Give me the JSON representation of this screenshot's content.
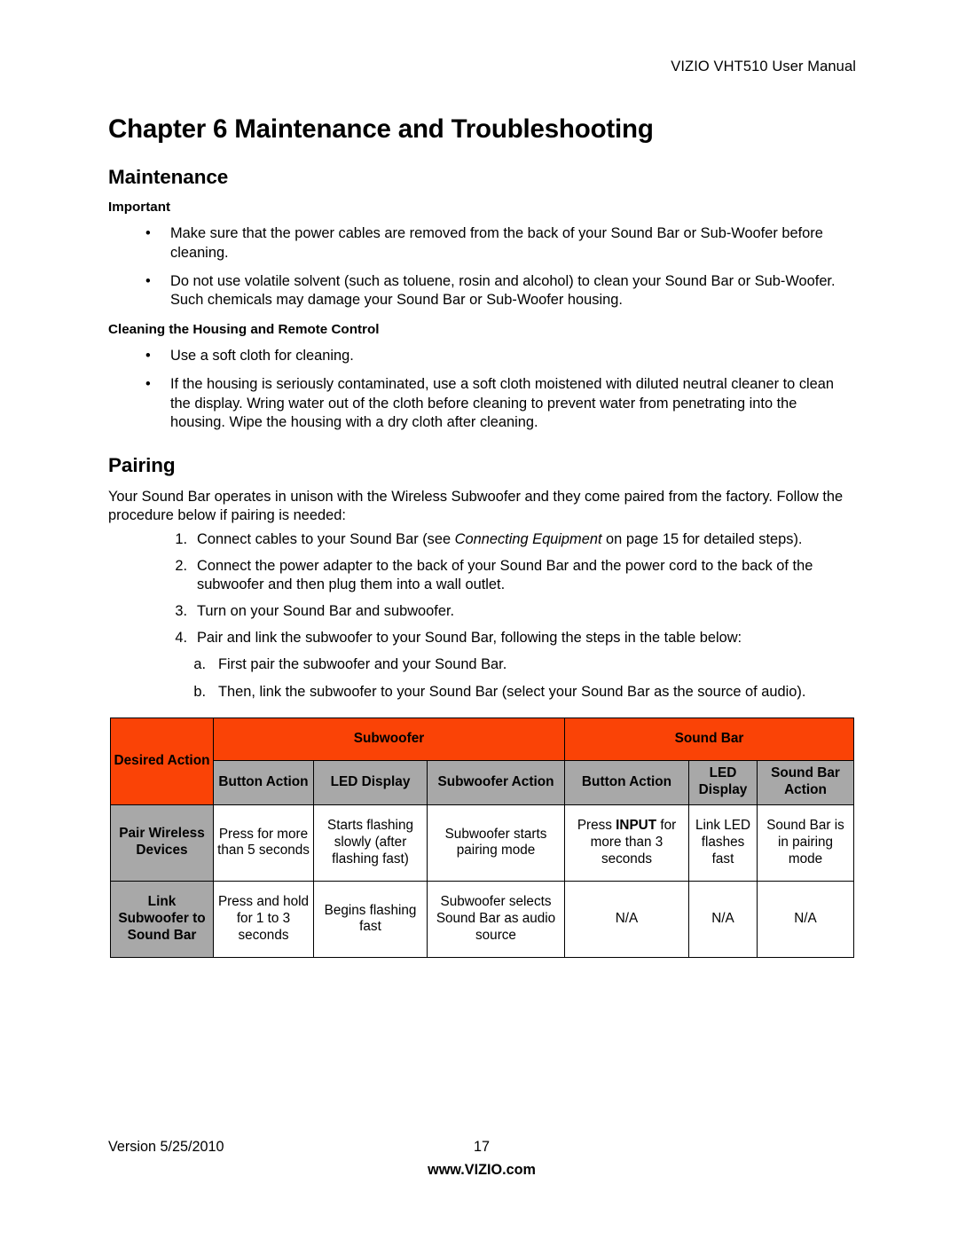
{
  "document": {
    "running_header": "VIZIO VHT510 User Manual",
    "chapter_title": "Chapter 6 Maintenance and Troubleshooting"
  },
  "maintenance": {
    "heading": "Maintenance",
    "important_label": "Important",
    "important_bullets": [
      "Make sure that the power cables are removed from the back of your Sound Bar or Sub-Woofer before cleaning.",
      "Do not use volatile solvent (such as toluene, rosin and alcohol) to clean your Sound Bar or Sub-Woofer. Such chemicals may damage your Sound Bar or Sub-Woofer housing."
    ],
    "cleaning_label": "Cleaning the Housing and Remote Control",
    "cleaning_bullets": [
      "Use a soft cloth for cleaning.",
      "If the housing is seriously contaminated, use a soft cloth moistened with diluted neutral cleaner to clean the display.  Wring water out of the cloth before cleaning to prevent water from penetrating into the housing. Wipe the housing with a dry cloth after cleaning."
    ],
    "bullet_glyph": "•"
  },
  "pairing": {
    "heading": "Pairing",
    "intro": "Your Sound Bar operates in unison with the Wireless Subwoofer and they come paired from the factory. Follow the procedure below if pairing is needed:",
    "steps": [
      {
        "num": "1.",
        "text_before": "Connect cables to your Sound Bar (see ",
        "italic": "Connecting Equipment",
        "text_after": " on page 15 for detailed steps)."
      },
      {
        "num": "2.",
        "text_before": "Connect the power adapter to the back of your Sound Bar and the power cord to the back of the subwoofer and then plug them into a wall outlet.",
        "italic": "",
        "text_after": ""
      },
      {
        "num": "3.",
        "text_before": "Turn on your Sound Bar and subwoofer.",
        "italic": "",
        "text_after": ""
      },
      {
        "num": "4.",
        "text_before": "Pair and link the subwoofer to your Sound Bar, following the steps in the table below:",
        "italic": "",
        "text_after": ""
      }
    ],
    "sub_steps": [
      {
        "num": "a.",
        "text": "First pair the subwoofer and your Sound Bar."
      },
      {
        "num": "b.",
        "text": "Then, link the subwoofer to your Sound Bar (select your Sound Bar as the source of audio)."
      }
    ]
  },
  "pair_table": {
    "colors": {
      "header_orange": "#fa4306",
      "header_gray": "#a8a8a8",
      "border": "#000000"
    },
    "group_header": {
      "desired_action": "Desired Action",
      "subwoofer": "Subwoofer",
      "sound_bar": "Sound Bar"
    },
    "column_header": {
      "blank": "",
      "subwoofer_button_action": "Button Action",
      "subwoofer_led_display": "LED Display",
      "subwoofer_action": "Subwoofer Action",
      "soundbar_button_action": "Button Action",
      "soundbar_led_display": "LED Display",
      "soundbar_action": "Sound Bar Action"
    },
    "rows": [
      {
        "desired_action": "Pair Wireless Devices",
        "sub_button_action": "Press for more than 5 seconds",
        "sub_led_display": "Starts flashing slowly (after flashing fast)",
        "sub_action": "Subwoofer starts pairing mode",
        "bar_button_action_before": "Press ",
        "bar_button_action_bold": "INPUT",
        "bar_button_action_after": " for more than 3 seconds",
        "bar_led_display": "Link LED flashes fast",
        "bar_action": "Sound Bar is in pairing mode"
      },
      {
        "desired_action": "Link Subwoofer to Sound Bar",
        "sub_button_action": "Press and hold for 1 to 3 seconds",
        "sub_led_display": "Begins flashing fast",
        "sub_action": "Subwoofer selects Sound Bar as audio source",
        "bar_button_action_before": "N/A",
        "bar_button_action_bold": "",
        "bar_button_action_after": "",
        "bar_led_display": "N/A",
        "bar_action": "N/A"
      }
    ]
  },
  "footer": {
    "version": "Version 5/25/2010",
    "page_number": "17",
    "website": "www.VIZIO.com"
  }
}
